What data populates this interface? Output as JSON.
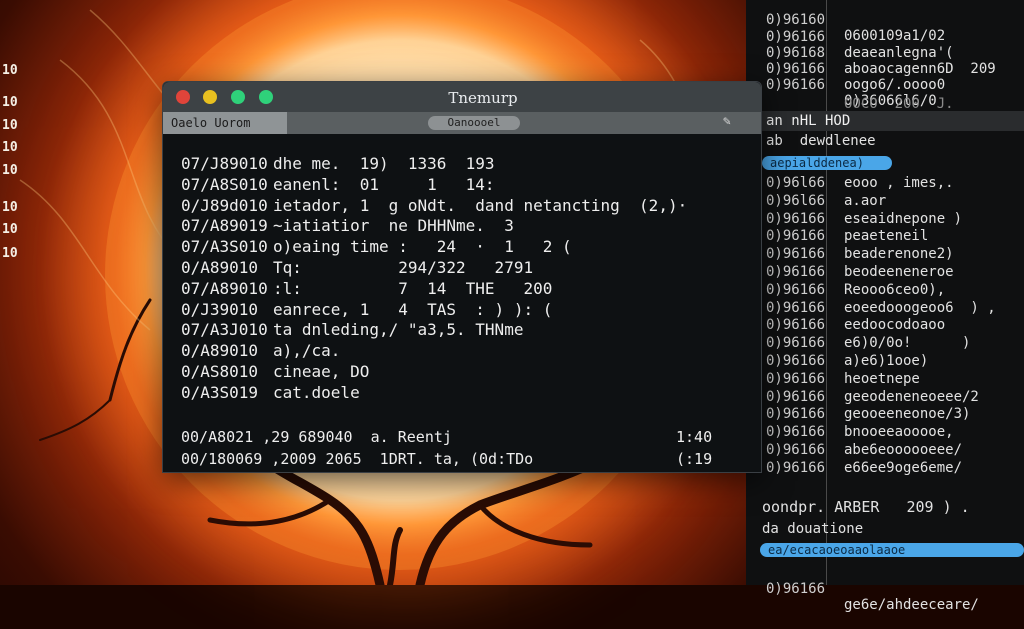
{
  "window": {
    "title": "Tnemurp",
    "traffic_lights": [
      "#e0443a",
      "#e8c020",
      "#2fd17a",
      "#2fd17a"
    ],
    "tabs": {
      "active_label": "Oaelo Uorom",
      "center_label": "Oanoooel",
      "edit_icon": "pencil-icon"
    }
  },
  "terminal": {
    "lines": [
      {
        "ts": "07/J89010",
        "text": "dhe me.  19)  1336  193"
      },
      {
        "ts": "07/A8S010",
        "text": "eanenl:  01     1   14:"
      },
      {
        "ts": "0/J89d010",
        "text": "ietador, 1  g oNdt.  dand netancting  (2,)·"
      },
      {
        "ts": "07/A89019",
        "text": "~iatiatior  ne DHHNme.  3"
      },
      {
        "ts": "07/A3S010",
        "text": "o)eaing time :   24  ·  1   2 ("
      },
      {
        "ts": "0/A89010",
        "text": "Tq:          294/322   2791"
      },
      {
        "ts": "07/A89010",
        "text": ":l:          7  14  THE   200"
      },
      {
        "ts": "0/J39010",
        "text": "eanrece, 1   4  TAS  : ) ): ("
      },
      {
        "ts": "07/A3J010",
        "text": "ta dnleding,/ \"a3,5. THNme"
      },
      {
        "ts": "0/A89010",
        "text": "a),/ca."
      },
      {
        "ts": "0/AS8010",
        "text": "cineae, DO"
      },
      {
        "ts": "0/A3S019",
        "text": "cat.doele"
      }
    ],
    "footer_lines": [
      {
        "left": "00/A8021 ,29 689040  a. Reentj",
        "right": "1:40"
      },
      {
        "left": "00/180069 ,2009 2065  1DRT. ta, (0d:TDo",
        "right": "(:19"
      }
    ]
  },
  "right_panel": {
    "top_lines": [
      {
        "num": "0)96160",
        "text": "0600109a1/02"
      },
      {
        "num": "0)96166",
        "text": "deaeanlegna'("
      },
      {
        "num": "0)96168",
        "text": "aboaocagenn6D  209"
      },
      {
        "num": "0)96166",
        "text": "oogo6/.oooo0"
      },
      {
        "num": "0)96166",
        "text": "0)36066l6/0"
      }
    ],
    "dim_line": "OOCO  200  J.",
    "header_1": "an  nHL  HOD",
    "sub_1": "ab  dewdlenee",
    "selected_1": "aepialddenea)",
    "mid_lines": [
      {
        "num": "0)96l66",
        "text": "eooo , imes,."
      },
      {
        "num": "0)96l66",
        "text": "a.aor"
      },
      {
        "num": "0)96166",
        "text": "eseaidnepone )"
      },
      {
        "num": "0)96166",
        "text": "peaeteneil"
      },
      {
        "num": "0)96166",
        "text": "beaderenone2)"
      },
      {
        "num": "0)96166",
        "text": "beodeeneneroe"
      },
      {
        "num": "0)96166",
        "text": "Reooo6ceo0),"
      },
      {
        "num": "0)96166",
        "text": "eoeedooogeoo6  ) ,"
      },
      {
        "num": "0)96166",
        "text": "eedoocodoaoo"
      },
      {
        "num": "0)96166",
        "text": "e6)0/0o!      )"
      },
      {
        "num": "0)96166",
        "text": "a)e6)1ooe)"
      },
      {
        "num": "0)96166",
        "text": "heoetnepe"
      },
      {
        "num": "0)96166",
        "text": "geeodeneneoeee/2"
      },
      {
        "num": "0)96166",
        "text": "geooeeneonoe/3)"
      },
      {
        "num": "0)96166",
        "text": "bnooeeaooooe,"
      },
      {
        "num": "0)96166",
        "text": "abe6eoooooeee/"
      },
      {
        "num": "0)96166",
        "text": "e66ee9oge6eme/"
      }
    ],
    "bottom_header": "oondpr. ARBER   209 ) .",
    "bottom_sub": "da douatione",
    "selected_2": "ea/ecacaoeoaaolaaoe",
    "last_line": {
      "num": "0)96166",
      "text": "ge6e/ahdeeceare/"
    }
  },
  "wallpaper": {
    "left_numbers": [
      "10",
      "10",
      "10",
      "10",
      "10",
      "10",
      "10",
      "10"
    ]
  }
}
